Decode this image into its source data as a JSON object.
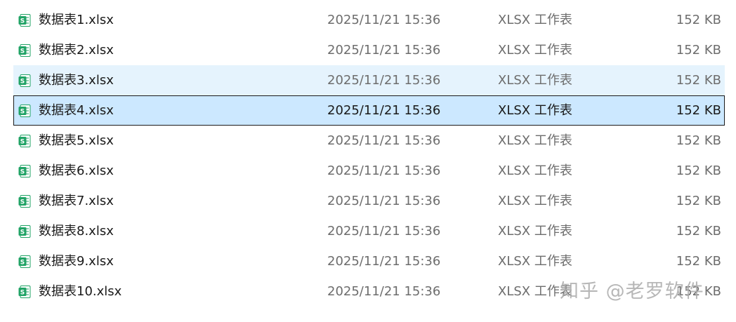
{
  "files": [
    {
      "name": "数据表1.xlsx",
      "modified": "2025/11/21 15:36",
      "type": "XLSX 工作表",
      "size": "152 KB",
      "icon": "spreadsheet-icon",
      "state": "normal"
    },
    {
      "name": "数据表2.xlsx",
      "modified": "2025/11/21 15:36",
      "type": "XLSX 工作表",
      "size": "152 KB",
      "icon": "spreadsheet-icon",
      "state": "normal"
    },
    {
      "name": "数据表3.xlsx",
      "modified": "2025/11/21 15:36",
      "type": "XLSX 工作表",
      "size": "152 KB",
      "icon": "spreadsheet-icon",
      "state": "hover"
    },
    {
      "name": "数据表4.xlsx",
      "modified": "2025/11/21 15:36",
      "type": "XLSX 工作表",
      "size": "152 KB",
      "icon": "spreadsheet-icon",
      "state": "selected"
    },
    {
      "name": "数据表5.xlsx",
      "modified": "2025/11/21 15:36",
      "type": "XLSX 工作表",
      "size": "152 KB",
      "icon": "spreadsheet-icon",
      "state": "normal"
    },
    {
      "name": "数据表6.xlsx",
      "modified": "2025/11/21 15:36",
      "type": "XLSX 工作表",
      "size": "152 KB",
      "icon": "spreadsheet-icon",
      "state": "normal"
    },
    {
      "name": "数据表7.xlsx",
      "modified": "2025/11/21 15:36",
      "type": "XLSX 工作表",
      "size": "152 KB",
      "icon": "spreadsheet-icon",
      "state": "normal"
    },
    {
      "name": "数据表8.xlsx",
      "modified": "2025/11/21 15:36",
      "type": "XLSX 工作表",
      "size": "152 KB",
      "icon": "spreadsheet-icon",
      "state": "normal"
    },
    {
      "name": "数据表9.xlsx",
      "modified": "2025/11/21 15:36",
      "type": "XLSX 工作表",
      "size": "152 KB",
      "icon": "spreadsheet-icon",
      "state": "normal"
    },
    {
      "name": "数据表10.xlsx",
      "modified": "2025/11/21 15:36",
      "type": "XLSX 工作表",
      "size": "152 KB",
      "icon": "spreadsheet-icon",
      "state": "normal"
    }
  ],
  "colors": {
    "icon_green": "#21a366",
    "hover_bg": "#e5f3fd",
    "selected_bg": "#cce8ff",
    "selected_border": "#1a1a1a"
  },
  "watermark": "知乎 @老罗软件"
}
